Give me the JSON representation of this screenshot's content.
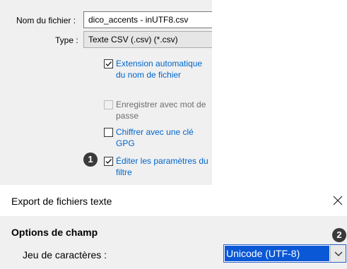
{
  "save_dialog": {
    "filename_label": "Nom du fichier :",
    "filename_value": "dico_accents - inUTF8.csv",
    "type_label": "Type :",
    "type_value": "Texte CSV (.csv) (*.csv)",
    "options": [
      {
        "label": "Extension automatique du nom de fichier",
        "checked": true,
        "enabled": true
      },
      {
        "label": "Enregistrer avec mot de passe",
        "checked": false,
        "enabled": false
      },
      {
        "label": "Chiffrer avec une clé GPG",
        "checked": false,
        "enabled": true
      },
      {
        "label": "Éditer les paramètres du filtre",
        "checked": true,
        "enabled": true
      }
    ],
    "step_badge": "1"
  },
  "export_dialog": {
    "title": "Export de fichiers texte",
    "close_icon": "close-icon",
    "section_title": "Options de champ",
    "charset_label": "Jeu de caractères :",
    "charset_value": "Unicode (UTF-8)",
    "step_badge": "2"
  },
  "colors": {
    "link_blue": "#0066cc",
    "selection_blue": "#0a58d6",
    "panel_bg": "#f0f0f0",
    "badge_bg": "#3a3a3a"
  }
}
